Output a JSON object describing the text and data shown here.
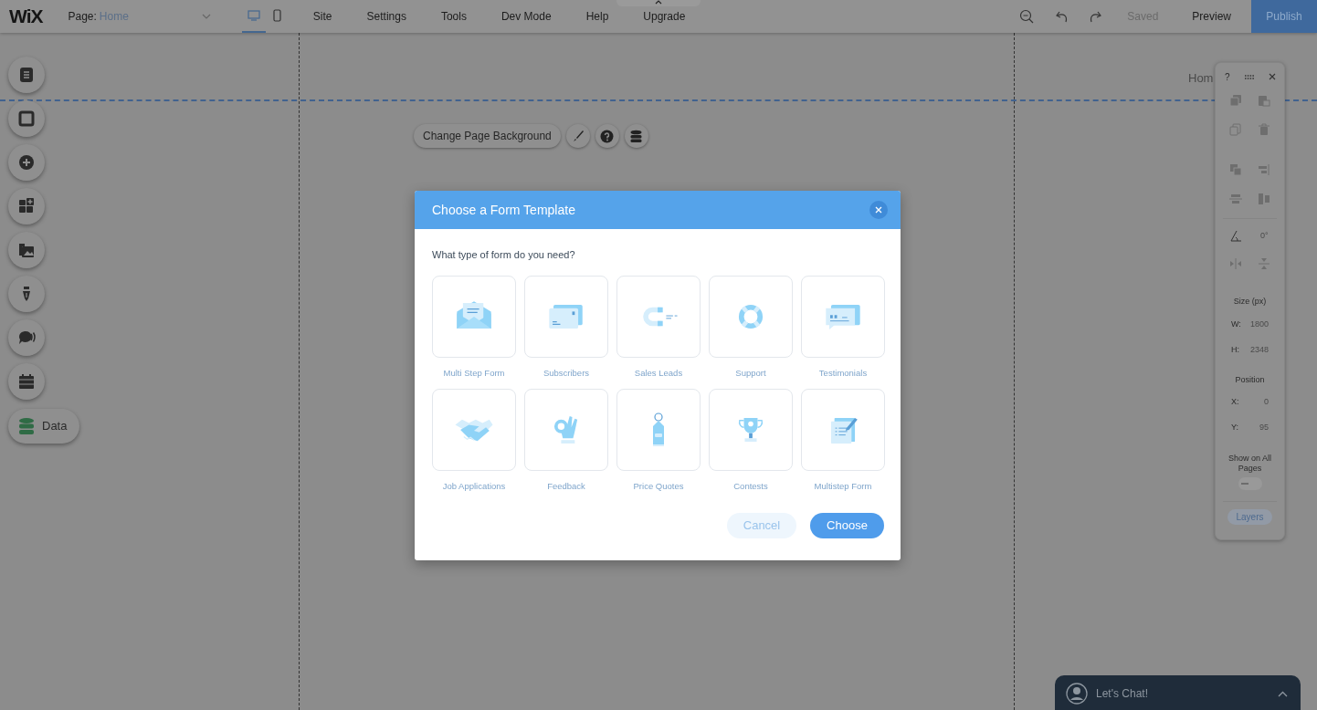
{
  "top_bar": {
    "logo": "WiX",
    "page_label": "Page:",
    "page_name": "Home",
    "view_toggles": [
      {
        "kind": "desktop",
        "selected": true
      },
      {
        "kind": "mobile",
        "selected": false
      }
    ],
    "menu": [
      "Site",
      "Settings",
      "Tools",
      "Dev Mode",
      "Help",
      "Upgrade"
    ],
    "status": "Saved",
    "preview": "Preview",
    "publish": "Publish"
  },
  "left_tools": {
    "data_label": "Data"
  },
  "canvas": {
    "page_title": "Hom",
    "background_button": "Change Page Background"
  },
  "dialog": {
    "title": "Choose a Form Template",
    "question": "What type of form do you need?",
    "templates": [
      {
        "label": "Multi Step Form",
        "kind": "envelope"
      },
      {
        "label": "Subscribers",
        "kind": "cards"
      },
      {
        "label": "Sales Leads",
        "kind": "magnet"
      },
      {
        "label": "Support",
        "kind": "lifebuoy"
      },
      {
        "label": "Testimonials",
        "kind": "quote"
      },
      {
        "label": "Job Applications",
        "kind": "handshake"
      },
      {
        "label": "Feedback",
        "kind": "hand"
      },
      {
        "label": "Price Quotes",
        "kind": "tag"
      },
      {
        "label": "Contests",
        "kind": "trophy"
      },
      {
        "label": "Multistep Form",
        "kind": "notepad"
      }
    ],
    "cancel": "Cancel",
    "choose": "Choose"
  },
  "right_panel": {
    "help": "?",
    "rotation": "0°",
    "size_title": "Size (px)",
    "width": {
      "label": "W:",
      "value": "1800"
    },
    "height": {
      "label": "H:",
      "value": "2348"
    },
    "position_title": "Position",
    "x": {
      "label": "X:",
      "value": "0"
    },
    "y": {
      "label": "Y:",
      "value": "95"
    },
    "show_on_all_pages": {
      "label": "Show on All Pages",
      "on": false
    },
    "layers": "Layers"
  },
  "chat": {
    "label": "Let's Chat!"
  }
}
